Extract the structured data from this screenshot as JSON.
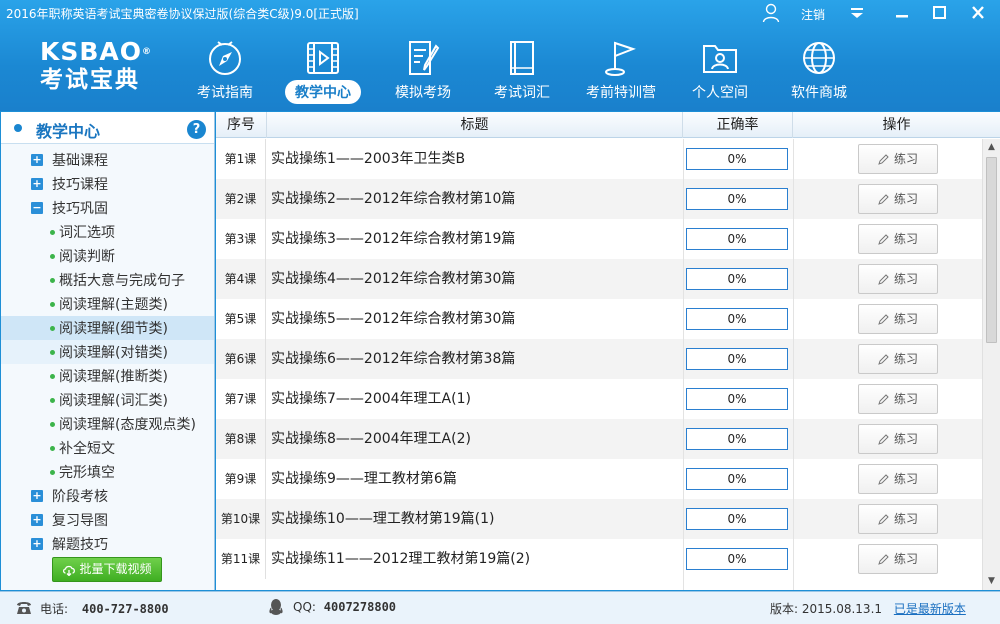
{
  "window": {
    "title": "2016年职称英语考试宝典密卷协议保过版(综合类C级)9.0[正式版]",
    "logout": "注销",
    "controls": [
      "dropdown-icon",
      "minimize-icon",
      "maximize-icon",
      "close-icon"
    ]
  },
  "logo": {
    "en": "KSBAO",
    "reg": "®",
    "cn": "考试宝典"
  },
  "nav": [
    {
      "label": "考试指南",
      "icon": "compass-icon",
      "active": false
    },
    {
      "label": "教学中心",
      "icon": "video-icon",
      "active": true
    },
    {
      "label": "模拟考场",
      "icon": "exam-icon",
      "active": false
    },
    {
      "label": "考试词汇",
      "icon": "book-icon",
      "active": false
    },
    {
      "label": "考前特训营",
      "icon": "flag-icon",
      "active": false
    },
    {
      "label": "个人空间",
      "icon": "folder-user-icon",
      "active": false
    },
    {
      "label": "软件商城",
      "icon": "globe-icon",
      "active": false
    }
  ],
  "sidebar": {
    "title": "教学中心",
    "help": "?",
    "items": [
      {
        "type": "category",
        "label": "基础课程",
        "sign": "+"
      },
      {
        "type": "category",
        "label": "技巧课程",
        "sign": "+"
      },
      {
        "type": "category",
        "label": "技巧巩固",
        "sign": "−"
      },
      {
        "type": "sub",
        "label": "词汇选项"
      },
      {
        "type": "sub",
        "label": "阅读判断"
      },
      {
        "type": "sub",
        "label": "概括大意与完成句子"
      },
      {
        "type": "sub",
        "label": "阅读理解(主题类)"
      },
      {
        "type": "sub",
        "label": "阅读理解(细节类)",
        "state": "selected"
      },
      {
        "type": "sub",
        "label": "阅读理解(对错类)",
        "state": "hover"
      },
      {
        "type": "sub",
        "label": "阅读理解(推断类)"
      },
      {
        "type": "sub",
        "label": "阅读理解(词汇类)"
      },
      {
        "type": "sub",
        "label": "阅读理解(态度观点类)"
      },
      {
        "type": "sub",
        "label": "补全短文"
      },
      {
        "type": "sub",
        "label": "完形填空"
      },
      {
        "type": "category",
        "label": "阶段考核",
        "sign": "+"
      },
      {
        "type": "category",
        "label": "复习导图",
        "sign": "+"
      },
      {
        "type": "category",
        "label": "解题技巧",
        "sign": "+"
      }
    ],
    "batch_download": "批量下载视频"
  },
  "table": {
    "headers": {
      "idx": "序号",
      "title": "标题",
      "rate": "正确率",
      "action": "操作"
    },
    "rows": [
      {
        "idx": "第1课",
        "title": "实战操练1——2003年卫生类B",
        "rate": "0%",
        "action": "练习"
      },
      {
        "idx": "第2课",
        "title": "实战操练2——2012年综合教材第10篇",
        "rate": "0%",
        "action": "练习"
      },
      {
        "idx": "第3课",
        "title": "实战操练3——2012年综合教材第19篇",
        "rate": "0%",
        "action": "练习"
      },
      {
        "idx": "第4课",
        "title": "实战操练4——2012年综合教材第30篇",
        "rate": "0%",
        "action": "练习"
      },
      {
        "idx": "第5课",
        "title": "实战操练5——2012年综合教材第30篇",
        "rate": "0%",
        "action": "练习"
      },
      {
        "idx": "第6课",
        "title": "实战操练6——2012年综合教材第38篇",
        "rate": "0%",
        "action": "练习"
      },
      {
        "idx": "第7课",
        "title": "实战操练7——2004年理工A(1)",
        "rate": "0%",
        "action": "练习"
      },
      {
        "idx": "第8课",
        "title": "实战操练8——2004年理工A(2)",
        "rate": "0%",
        "action": "练习"
      },
      {
        "idx": "第9课",
        "title": "实战操练9——理工教材第6篇",
        "rate": "0%",
        "action": "练习"
      },
      {
        "idx": "第10课",
        "title": "实战操练10——理工教材第19篇(1)",
        "rate": "0%",
        "action": "练习"
      },
      {
        "idx": "第11课",
        "title": "实战操练11——2012理工教材第19篇(2)",
        "rate": "0%",
        "action": "练习"
      }
    ]
  },
  "footer": {
    "phone_label": "电话:",
    "phone": "400-727-8800",
    "qq_label": "QQ:",
    "qq": "4007278800",
    "version": "版本: 2015.08.13.1",
    "latest": "已是最新版本"
  },
  "colors": {
    "header_blue": "#1b88d3",
    "accent": "#1a86d0",
    "button_green": "#3fae22"
  }
}
